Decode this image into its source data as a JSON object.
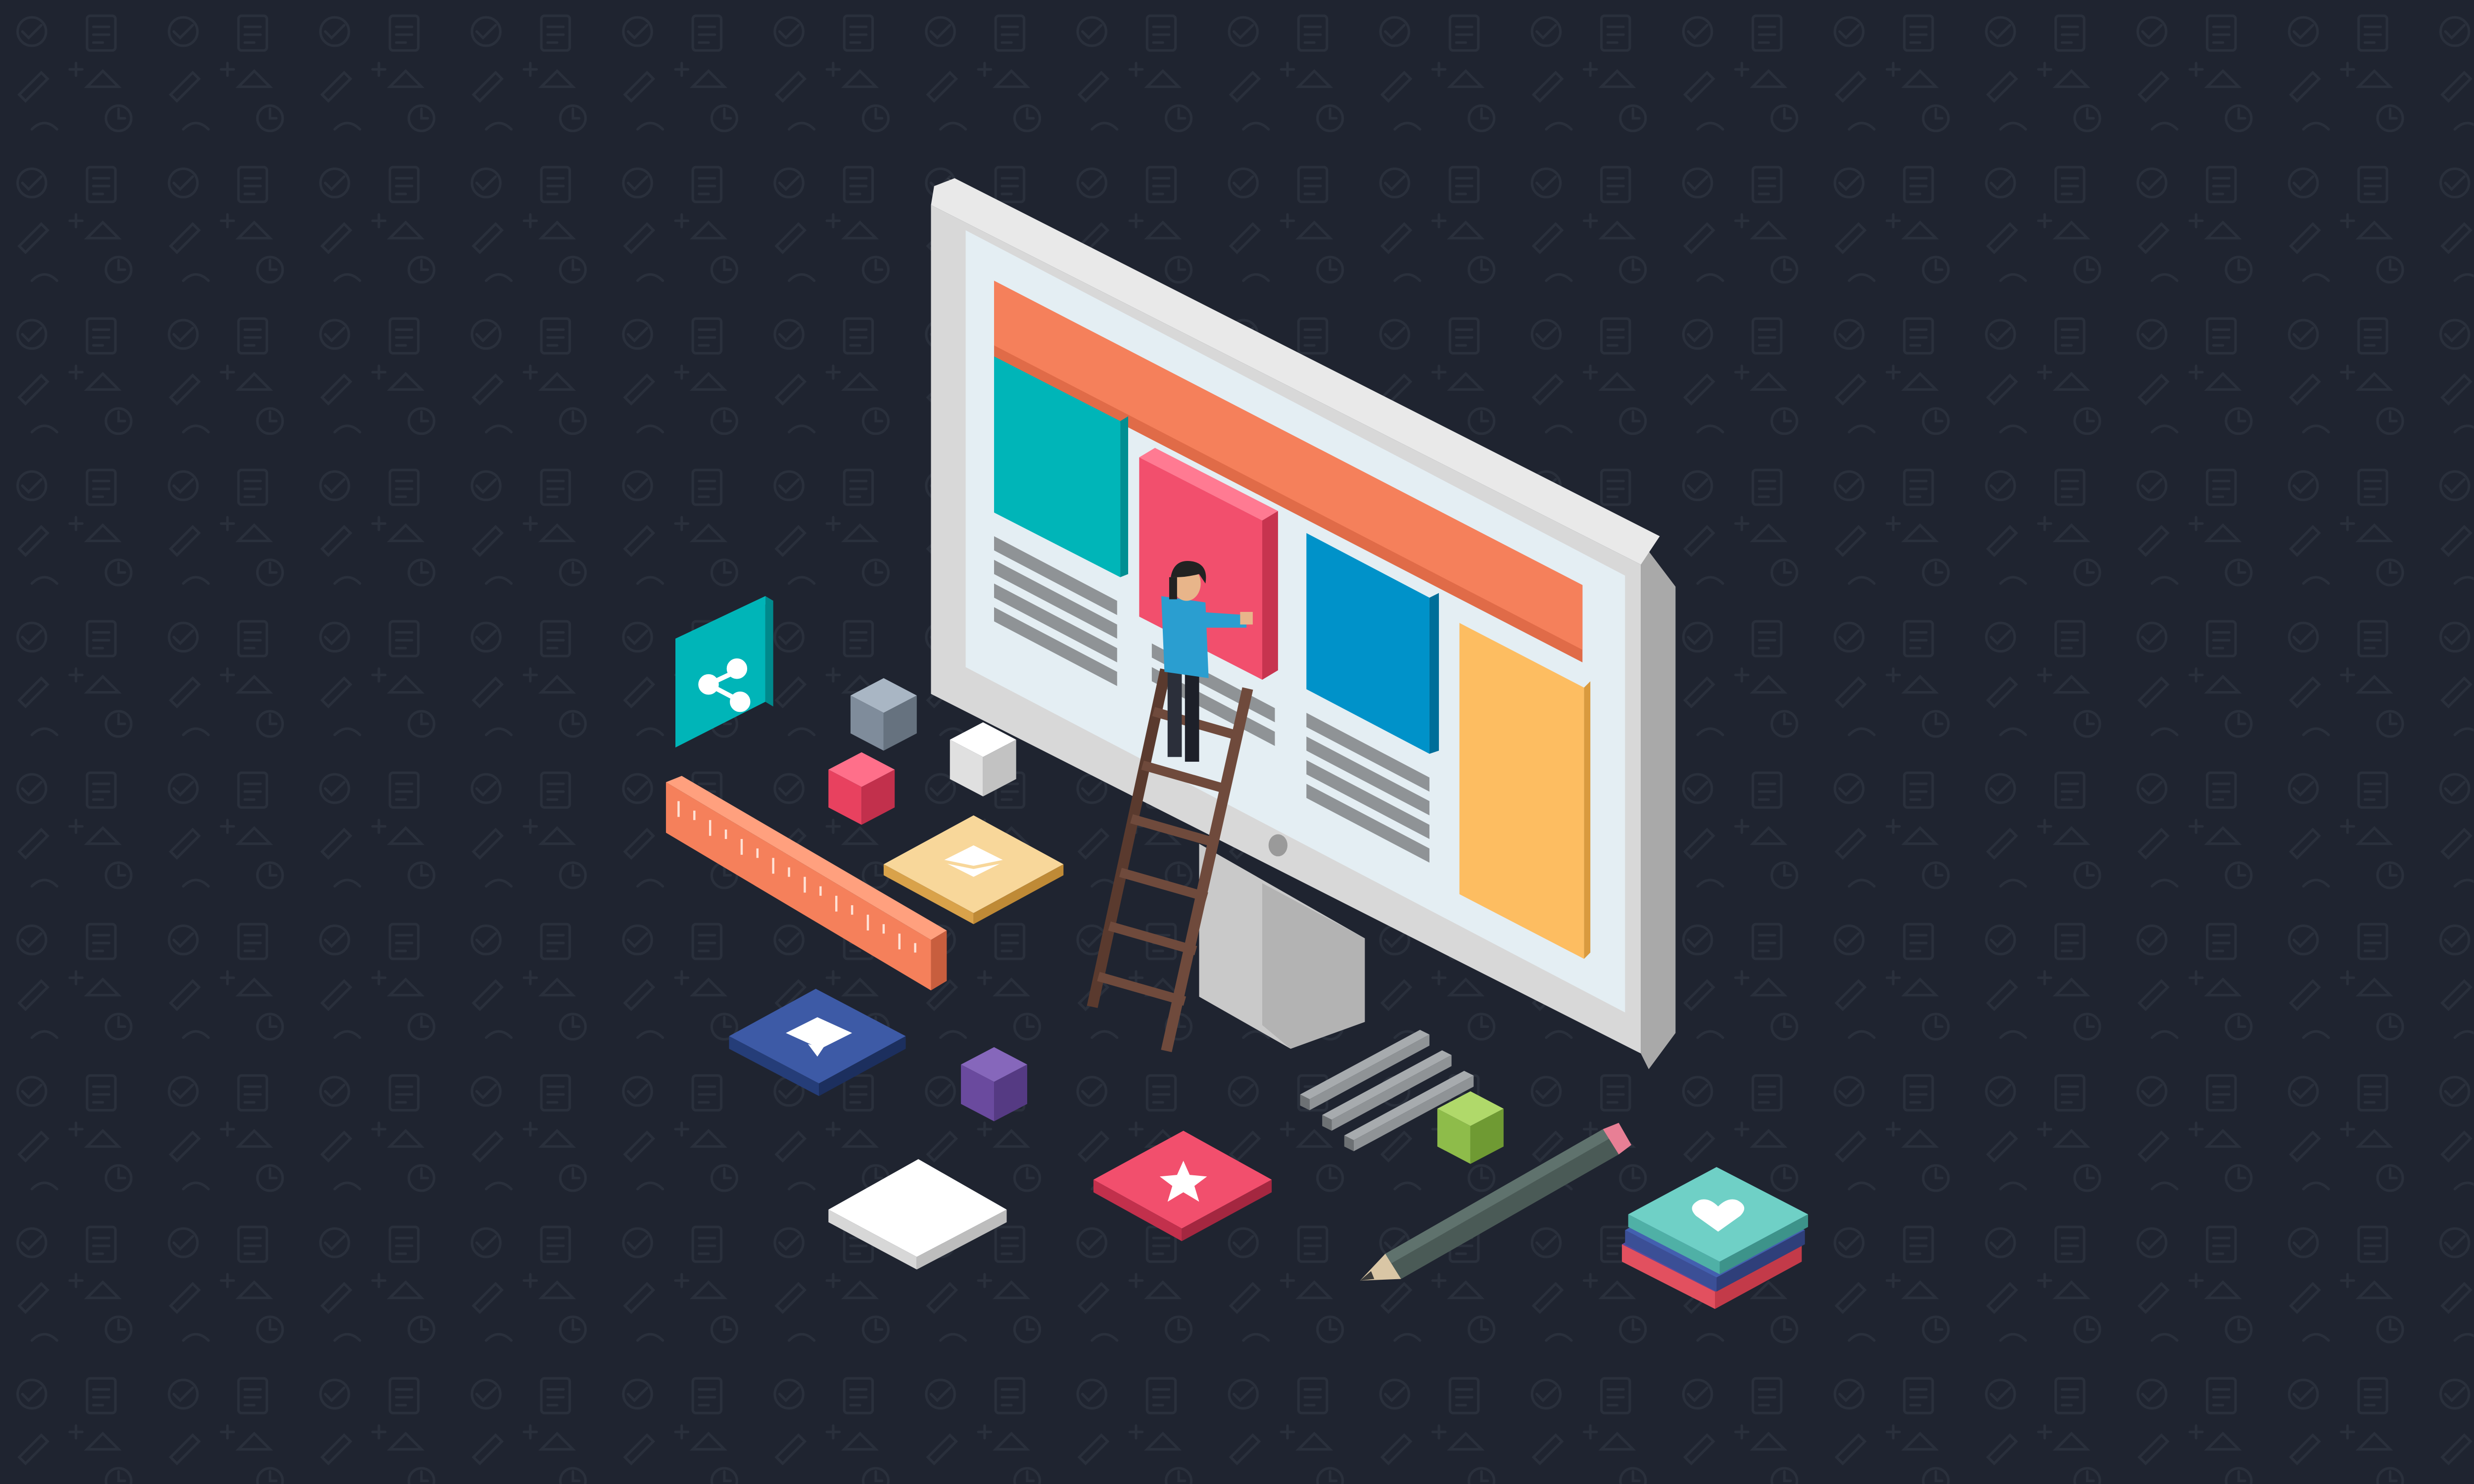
{
  "scene": {
    "background_color": "#1f2430",
    "pattern_color": "#2a303c",
    "monitor_frame_color": "#d6d6d6",
    "monitor_screen_color": "#e4eef3",
    "palette": {
      "orange_bar": "#f5805b",
      "teal": "#00b5b8",
      "pink": "#f24f6d",
      "blue": "#0092c9",
      "yellow": "#fdbd61",
      "gray_lines": "#8f9396",
      "brown_ladder": "#6f4a3c",
      "purple": "#6a4a9e",
      "green": "#8ebc4a",
      "navy": "#2f4a8f",
      "cream": "#f8d79a",
      "white": "#f4f4f4"
    },
    "icons": [
      "share-icon",
      "mail-icon",
      "chat-bubble-icon",
      "star-icon",
      "heart-icon",
      "monitor-icon",
      "ladder-icon",
      "person-icon",
      "ruler-icon",
      "pencil-icon"
    ]
  }
}
